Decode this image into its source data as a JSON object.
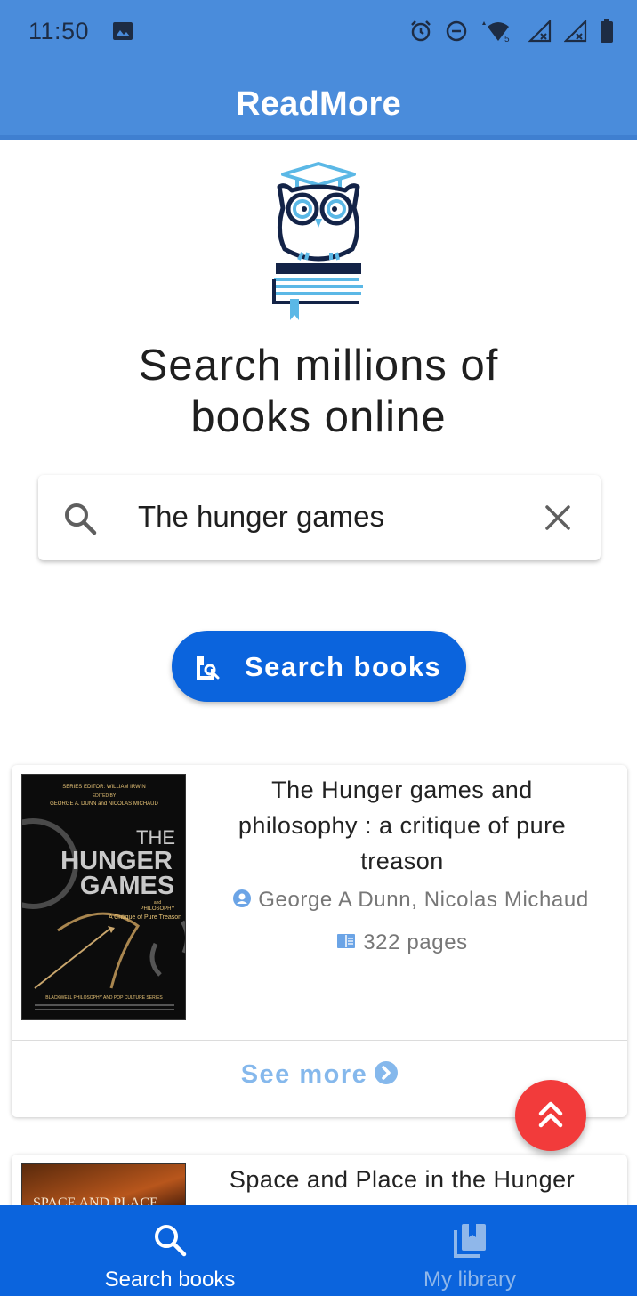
{
  "status_bar": {
    "time": "11:50",
    "icons": [
      "image-icon",
      "alarm-icon",
      "do-not-disturb-icon",
      "wifi-icon",
      "signal-icon",
      "signal-icon",
      "battery-icon"
    ]
  },
  "app_bar": {
    "title": "ReadMore"
  },
  "hero": {
    "headline_line1": "Search millions of",
    "headline_line2": "books online"
  },
  "search": {
    "value": "The hunger games",
    "button_label": "Search books"
  },
  "results": [
    {
      "title": "The Hunger games and philosophy : a critique of pure treason",
      "authors": "George A Dunn,  Nicolas Michaud",
      "pages": "322 pages",
      "see_more": "See more",
      "cover": {
        "series_line": "SERIES EDITOR: WILLIAM IRWIN",
        "edited_by": "EDITED BY",
        "editors": "GEORGE A. DUNN and NICOLAS MICHAUD",
        "the": "THE",
        "hunger": "HUNGER",
        "games": "GAMES",
        "and": "and",
        "philosophy": "PHILOSOPHY",
        "subtitle": "A Critique of Pure Treason",
        "footer": "BLACKWELL PHILOSOPHY AND POP CULTURE SERIES"
      }
    },
    {
      "title": "Space and Place in the Hunger Games: New Readings of the",
      "cover": {
        "title": "SPACE AND PLACE"
      }
    }
  ],
  "bottom_nav": {
    "search_label": "Search books",
    "library_label": "My library"
  },
  "colors": {
    "app_bar": "#4A8CDB",
    "primary": "#0B64DD",
    "fab": "#F23B3B",
    "link": "#85B8EC"
  }
}
